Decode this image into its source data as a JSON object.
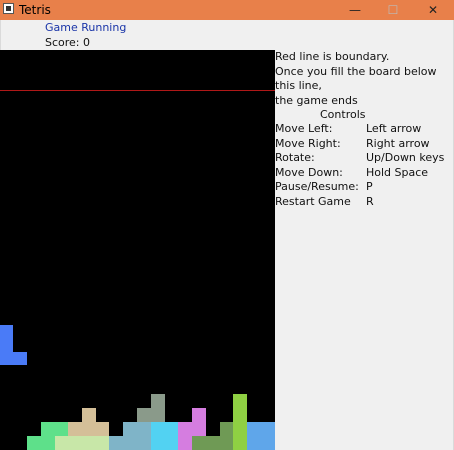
{
  "window": {
    "title": "Tetris",
    "minimize_glyph": "—",
    "maximize_glyph": "☐",
    "close_glyph": "✕"
  },
  "status": "Game Running",
  "score_text": "Score: 0",
  "info": {
    "line1": "Red line is boundary.",
    "line2": "Once you fill the board below this line,",
    "line3": "the game ends"
  },
  "controls": {
    "heading": "Controls",
    "rows": [
      {
        "action": "Move Left:",
        "key": "Left arrow"
      },
      {
        "action": "Move Right:",
        "key": "Right arrow"
      },
      {
        "action": "Rotate:",
        "key": "Up/Down keys"
      },
      {
        "action": "Move Down:",
        "key": "Hold Space"
      },
      {
        "action": "Pause/Resume:",
        "key": "P"
      },
      {
        "action": "Restart Game",
        "key": "R"
      }
    ]
  },
  "colors": {
    "boundary": "#b01818",
    "board": "#000000",
    "status_text": "#1a35a8",
    "titlebar": "#e8804a"
  }
}
